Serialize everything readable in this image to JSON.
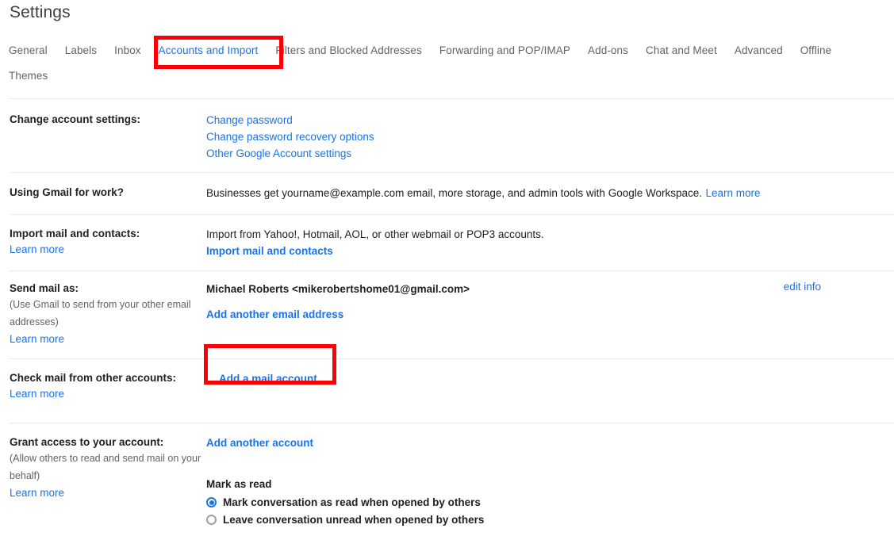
{
  "page": {
    "title": "Settings"
  },
  "tabs": [
    {
      "label": "General",
      "active": false
    },
    {
      "label": "Labels",
      "active": false
    },
    {
      "label": "Inbox",
      "active": false
    },
    {
      "label": "Accounts and Import",
      "active": true
    },
    {
      "label": "Filters and Blocked Addresses",
      "active": false
    },
    {
      "label": "Forwarding and POP/IMAP",
      "active": false
    },
    {
      "label": "Add-ons",
      "active": false
    },
    {
      "label": "Chat and Meet",
      "active": false
    },
    {
      "label": "Advanced",
      "active": false
    },
    {
      "label": "Offline",
      "active": false
    },
    {
      "label": "Themes",
      "active": false
    }
  ],
  "sections": {
    "change_account": {
      "label": "Change account settings:",
      "links": [
        "Change password",
        "Change password recovery options",
        "Other Google Account settings"
      ]
    },
    "gmail_for_work": {
      "label": "Using Gmail for work?",
      "text": "Businesses get yourname@example.com email, more storage, and admin tools with Google Workspace.",
      "learn_more": "Learn more"
    },
    "import_mail": {
      "label": "Import mail and contacts:",
      "learn_more": "Learn more",
      "text": "Import from Yahoo!, Hotmail, AOL, or other webmail or POP3 accounts.",
      "action": "Import mail and contacts"
    },
    "send_mail_as": {
      "label": "Send mail as:",
      "sub": "(Use Gmail to send from your other email addresses)",
      "learn_more": "Learn more",
      "account": "Michael Roberts <mikerobertshome01@gmail.com>",
      "edit_info": "edit info",
      "action": "Add another email address"
    },
    "check_mail": {
      "label": "Check mail from other accounts:",
      "learn_more": "Learn more",
      "action": "Add a mail account"
    },
    "grant_access": {
      "label": "Grant access to your account:",
      "sub": "(Allow others to read and send mail on your behalf)",
      "learn_more": "Learn more",
      "action": "Add another account",
      "mark_as_read_title": "Mark as read",
      "options": [
        {
          "label": "Mark conversation as read when opened by others",
          "selected": true
        },
        {
          "label": "Leave conversation unread when opened by others",
          "selected": false
        }
      ]
    }
  },
  "annotations": {
    "highlight_color": "#fb0007",
    "boxes": [
      {
        "target": "tab-accounts-and-import"
      },
      {
        "target": "add-a-mail-account-link"
      }
    ]
  },
  "colors": {
    "link": "#1a73e8",
    "text": "#202124",
    "muted": "#5f6368",
    "divider": "#e8eaed",
    "highlight": "#fb0007"
  }
}
